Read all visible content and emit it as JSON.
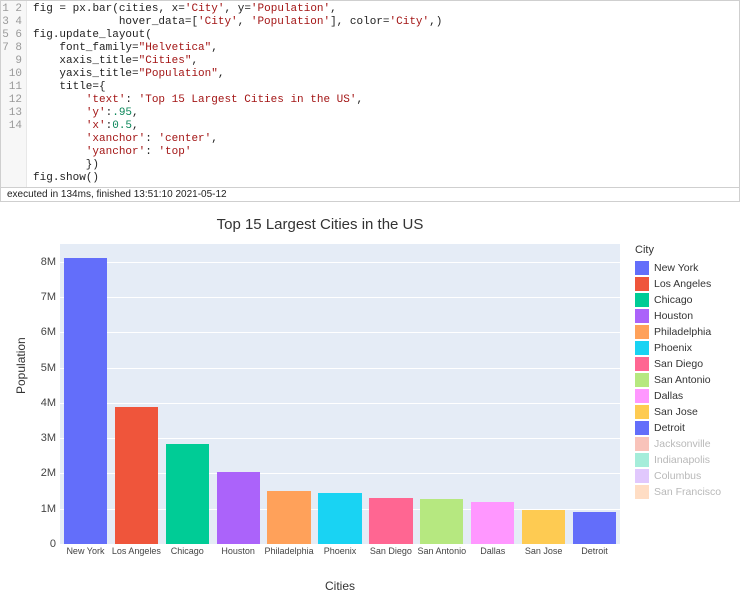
{
  "code": {
    "lines": [
      [
        [
          "id",
          "fig "
        ],
        [
          "pun",
          "="
        ],
        [
          "id",
          " px"
        ],
        [
          "pun",
          "."
        ],
        [
          "id",
          "bar"
        ],
        [
          "pun",
          "("
        ],
        [
          "id",
          "cities"
        ],
        [
          "pun",
          ", "
        ],
        [
          "id",
          "x"
        ],
        [
          "pun",
          "="
        ],
        [
          "str",
          "'City'"
        ],
        [
          "pun",
          ", "
        ],
        [
          "id",
          "y"
        ],
        [
          "pun",
          "="
        ],
        [
          "str",
          "'Population'"
        ],
        [
          "pun",
          ","
        ]
      ],
      [
        [
          "id",
          "             hover_data"
        ],
        [
          "pun",
          "="
        ],
        [
          "pun",
          "["
        ],
        [
          "str",
          "'City'"
        ],
        [
          "pun",
          ", "
        ],
        [
          "str",
          "'Population'"
        ],
        [
          "pun",
          "], "
        ],
        [
          "id",
          "color"
        ],
        [
          "pun",
          "="
        ],
        [
          "str",
          "'City'"
        ],
        [
          "pun",
          ",)"
        ]
      ],
      [
        [
          "id",
          "fig"
        ],
        [
          "pun",
          "."
        ],
        [
          "id",
          "update_layout"
        ],
        [
          "pun",
          "("
        ]
      ],
      [
        [
          "id",
          "    font_family"
        ],
        [
          "pun",
          "="
        ],
        [
          "str",
          "\"Helvetica\""
        ],
        [
          "pun",
          ","
        ]
      ],
      [
        [
          "id",
          "    xaxis_title"
        ],
        [
          "pun",
          "="
        ],
        [
          "str",
          "\"Cities\""
        ],
        [
          "pun",
          ","
        ]
      ],
      [
        [
          "id",
          "    yaxis_title"
        ],
        [
          "pun",
          "="
        ],
        [
          "str",
          "\"Population\""
        ],
        [
          "pun",
          ","
        ]
      ],
      [
        [
          "id",
          "    title"
        ],
        [
          "pun",
          "="
        ],
        [
          "pun",
          "{"
        ]
      ],
      [
        [
          "pun",
          "        "
        ],
        [
          "str",
          "'text'"
        ],
        [
          "pun",
          ": "
        ],
        [
          "str",
          "'Top 15 Largest Cities in the US'"
        ],
        [
          "pun",
          ","
        ]
      ],
      [
        [
          "pun",
          "        "
        ],
        [
          "str",
          "'y'"
        ],
        [
          "pun",
          ":"
        ],
        [
          "num",
          ".95"
        ],
        [
          "pun",
          ","
        ]
      ],
      [
        [
          "pun",
          "        "
        ],
        [
          "str",
          "'x'"
        ],
        [
          "pun",
          ":"
        ],
        [
          "num",
          "0.5"
        ],
        [
          "pun",
          ","
        ]
      ],
      [
        [
          "pun",
          "        "
        ],
        [
          "str",
          "'xanchor'"
        ],
        [
          "pun",
          ": "
        ],
        [
          "str",
          "'center'"
        ],
        [
          "pun",
          ","
        ]
      ],
      [
        [
          "pun",
          "        "
        ],
        [
          "str",
          "'yanchor'"
        ],
        [
          "pun",
          ": "
        ],
        [
          "str",
          "'top'"
        ]
      ],
      [
        [
          "pun",
          "        })"
        ]
      ],
      [
        [
          "id",
          "fig"
        ],
        [
          "pun",
          "."
        ],
        [
          "id",
          "show"
        ],
        [
          "pun",
          "()"
        ]
      ]
    ],
    "line_numbers": [
      "1",
      "2",
      "3",
      "4",
      "5",
      "6",
      "7",
      "8",
      "9",
      "10",
      "11",
      "12",
      "13",
      "14"
    ]
  },
  "execution_status": "executed in 134ms, finished 13:51:10 2021-05-12",
  "chart_data": {
    "type": "bar",
    "title": "Top 15 Largest Cities in the US",
    "xlabel": "Cities",
    "ylabel": "Population",
    "ylim": [
      0,
      8500000
    ],
    "y_ticks": [
      {
        "v": 0,
        "label": "0"
      },
      {
        "v": 1000000,
        "label": "1M"
      },
      {
        "v": 2000000,
        "label": "2M"
      },
      {
        "v": 3000000,
        "label": "3M"
      },
      {
        "v": 4000000,
        "label": "4M"
      },
      {
        "v": 5000000,
        "label": "5M"
      },
      {
        "v": 6000000,
        "label": "6M"
      },
      {
        "v": 7000000,
        "label": "7M"
      },
      {
        "v": 8000000,
        "label": "8M"
      }
    ],
    "categories": [
      "New York",
      "Los Angeles",
      "Chicago",
      "Houston",
      "Philadelphia",
      "Phoenix",
      "San Diego",
      "San Antonio",
      "Dallas",
      "San Jose",
      "Detroit"
    ],
    "values": [
      8100000,
      3880000,
      2830000,
      2030000,
      1500000,
      1450000,
      1300000,
      1280000,
      1200000,
      950000,
      920000
    ],
    "colors": [
      "#636efa",
      "#ef553b",
      "#00cc96",
      "#ab63fa",
      "#ffa15a",
      "#19d3f3",
      "#ff6692",
      "#b6e880",
      "#ff97ff",
      "#fecb52",
      "#636efa"
    ],
    "legend_title": "City",
    "legend_items": [
      {
        "label": "New York",
        "color": "#636efa",
        "dim": false
      },
      {
        "label": "Los Angeles",
        "color": "#ef553b",
        "dim": false
      },
      {
        "label": "Chicago",
        "color": "#00cc96",
        "dim": false
      },
      {
        "label": "Houston",
        "color": "#ab63fa",
        "dim": false
      },
      {
        "label": "Philadelphia",
        "color": "#ffa15a",
        "dim": false
      },
      {
        "label": "Phoenix",
        "color": "#19d3f3",
        "dim": false
      },
      {
        "label": "San Diego",
        "color": "#ff6692",
        "dim": false
      },
      {
        "label": "San Antonio",
        "color": "#b6e880",
        "dim": false
      },
      {
        "label": "Dallas",
        "color": "#ff97ff",
        "dim": false
      },
      {
        "label": "San Jose",
        "color": "#fecb52",
        "dim": false
      },
      {
        "label": "Detroit",
        "color": "#636efa",
        "dim": false
      },
      {
        "label": "Jacksonville",
        "color": "#ef553b",
        "dim": true
      },
      {
        "label": "Indianapolis",
        "color": "#00cc96",
        "dim": true
      },
      {
        "label": "Columbus",
        "color": "#ab63fa",
        "dim": true
      },
      {
        "label": "San Francisco",
        "color": "#ffa15a",
        "dim": true
      }
    ]
  }
}
